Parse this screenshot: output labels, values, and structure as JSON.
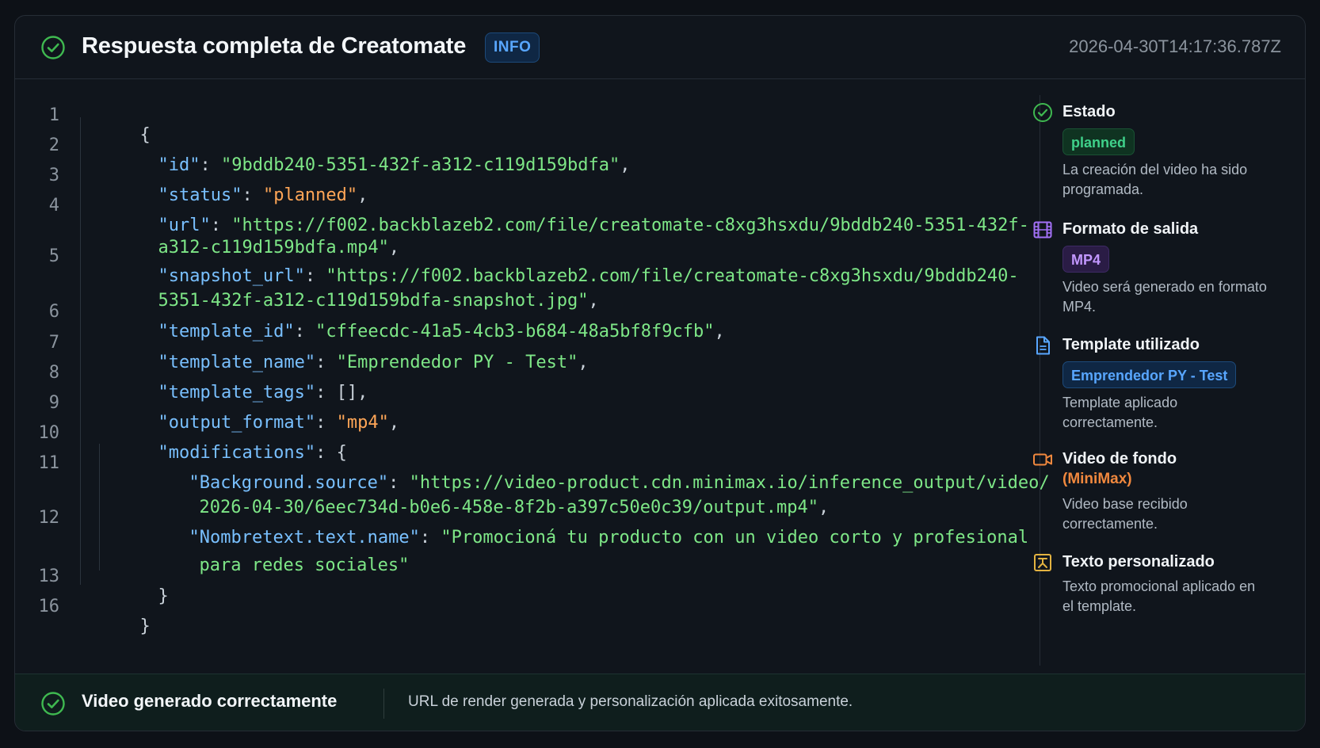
{
  "header": {
    "title": "Respuesta completa de Creatomate",
    "badge": "INFO",
    "timestamp": "2026-04-30T14:17:36.787Z"
  },
  "code": {
    "line_numbers": [
      "1",
      "2",
      "3",
      "4",
      "5",
      "6",
      "7",
      "8",
      "9",
      "10",
      "11",
      "12",
      "13",
      "16"
    ],
    "lines": [
      [
        "{"
      ],
      [
        "\"id\"",
        ": ",
        "\"9bddb240-5351-432f-a312-c119d159bdfa\"",
        ","
      ],
      [
        "\"status\"",
        ": ",
        "\"planned\"",
        ","
      ],
      [
        "\"url\"",
        ": ",
        "\"https://f002.backblazeb2.com/file/creatomate-c8xg3hsxdu/9bddb240-5351-432f-",
        "a312-c119d159bdfa.mp4\"",
        ","
      ],
      [
        "\"snapshot_url\"",
        ": ",
        "\"https://f002.backblazeb2.com/file/creatomate-c8xg3hsxdu/9bddb240-",
        "5351-432f-a312-c119d159bdfa-snapshot.jpg\"",
        ","
      ],
      [
        "\"template_id\"",
        ": ",
        "\"cffeecdc-41a5-4cb3-b684-48a5bf8f9cfb\"",
        ","
      ],
      [
        "\"template_name\"",
        ": ",
        "\"Emprendedor PY - Test\"",
        ","
      ],
      [
        "\"template_tags\"",
        ": ",
        "[]",
        ","
      ],
      [
        "\"output_format\"",
        ": ",
        "\"mp4\"",
        ","
      ],
      [
        "\"modifications\"",
        ": ",
        "{"
      ],
      [
        "\"Background.source\"",
        ": ",
        "\"https://video-product.cdn.minimax.io/inference_output/video/",
        "2026-04-30/6eec734d-b0e6-458e-8f2b-a397c50e0c39/output.mp4\"",
        ","
      ],
      [
        "\"Nombretext.text.name\"",
        ": ",
        "\"Promocioná tu producto con un video corto y profesional",
        "para redes sociales\""
      ],
      [
        "}"
      ],
      [
        "}"
      ]
    ]
  },
  "sidebar": {
    "items": [
      {
        "title": "Estado",
        "pill": "planned",
        "desc": "La creación del video ha sido programada."
      },
      {
        "title": "Formato de salida",
        "pill": "MP4",
        "desc": "Video será generado en formato MP4."
      },
      {
        "title": "Template utilizado",
        "pill": "Emprendedor PY - Test",
        "desc": "Template aplicado correctamente."
      },
      {
        "title": "Video de fondo",
        "subtitle": "(MiniMax)",
        "desc": "Video base recibido correctamente."
      },
      {
        "title": "Texto personalizado",
        "desc": "Texto promocional aplicado en el template."
      }
    ]
  },
  "footer": {
    "title": "Video generado correctamente",
    "message": "URL de render generada y personalización aplicada exitosamente."
  },
  "colors": {
    "key": "#79c0ff",
    "string": "#7ee787",
    "orange": "#ffa657",
    "success": "#3fd18a"
  }
}
